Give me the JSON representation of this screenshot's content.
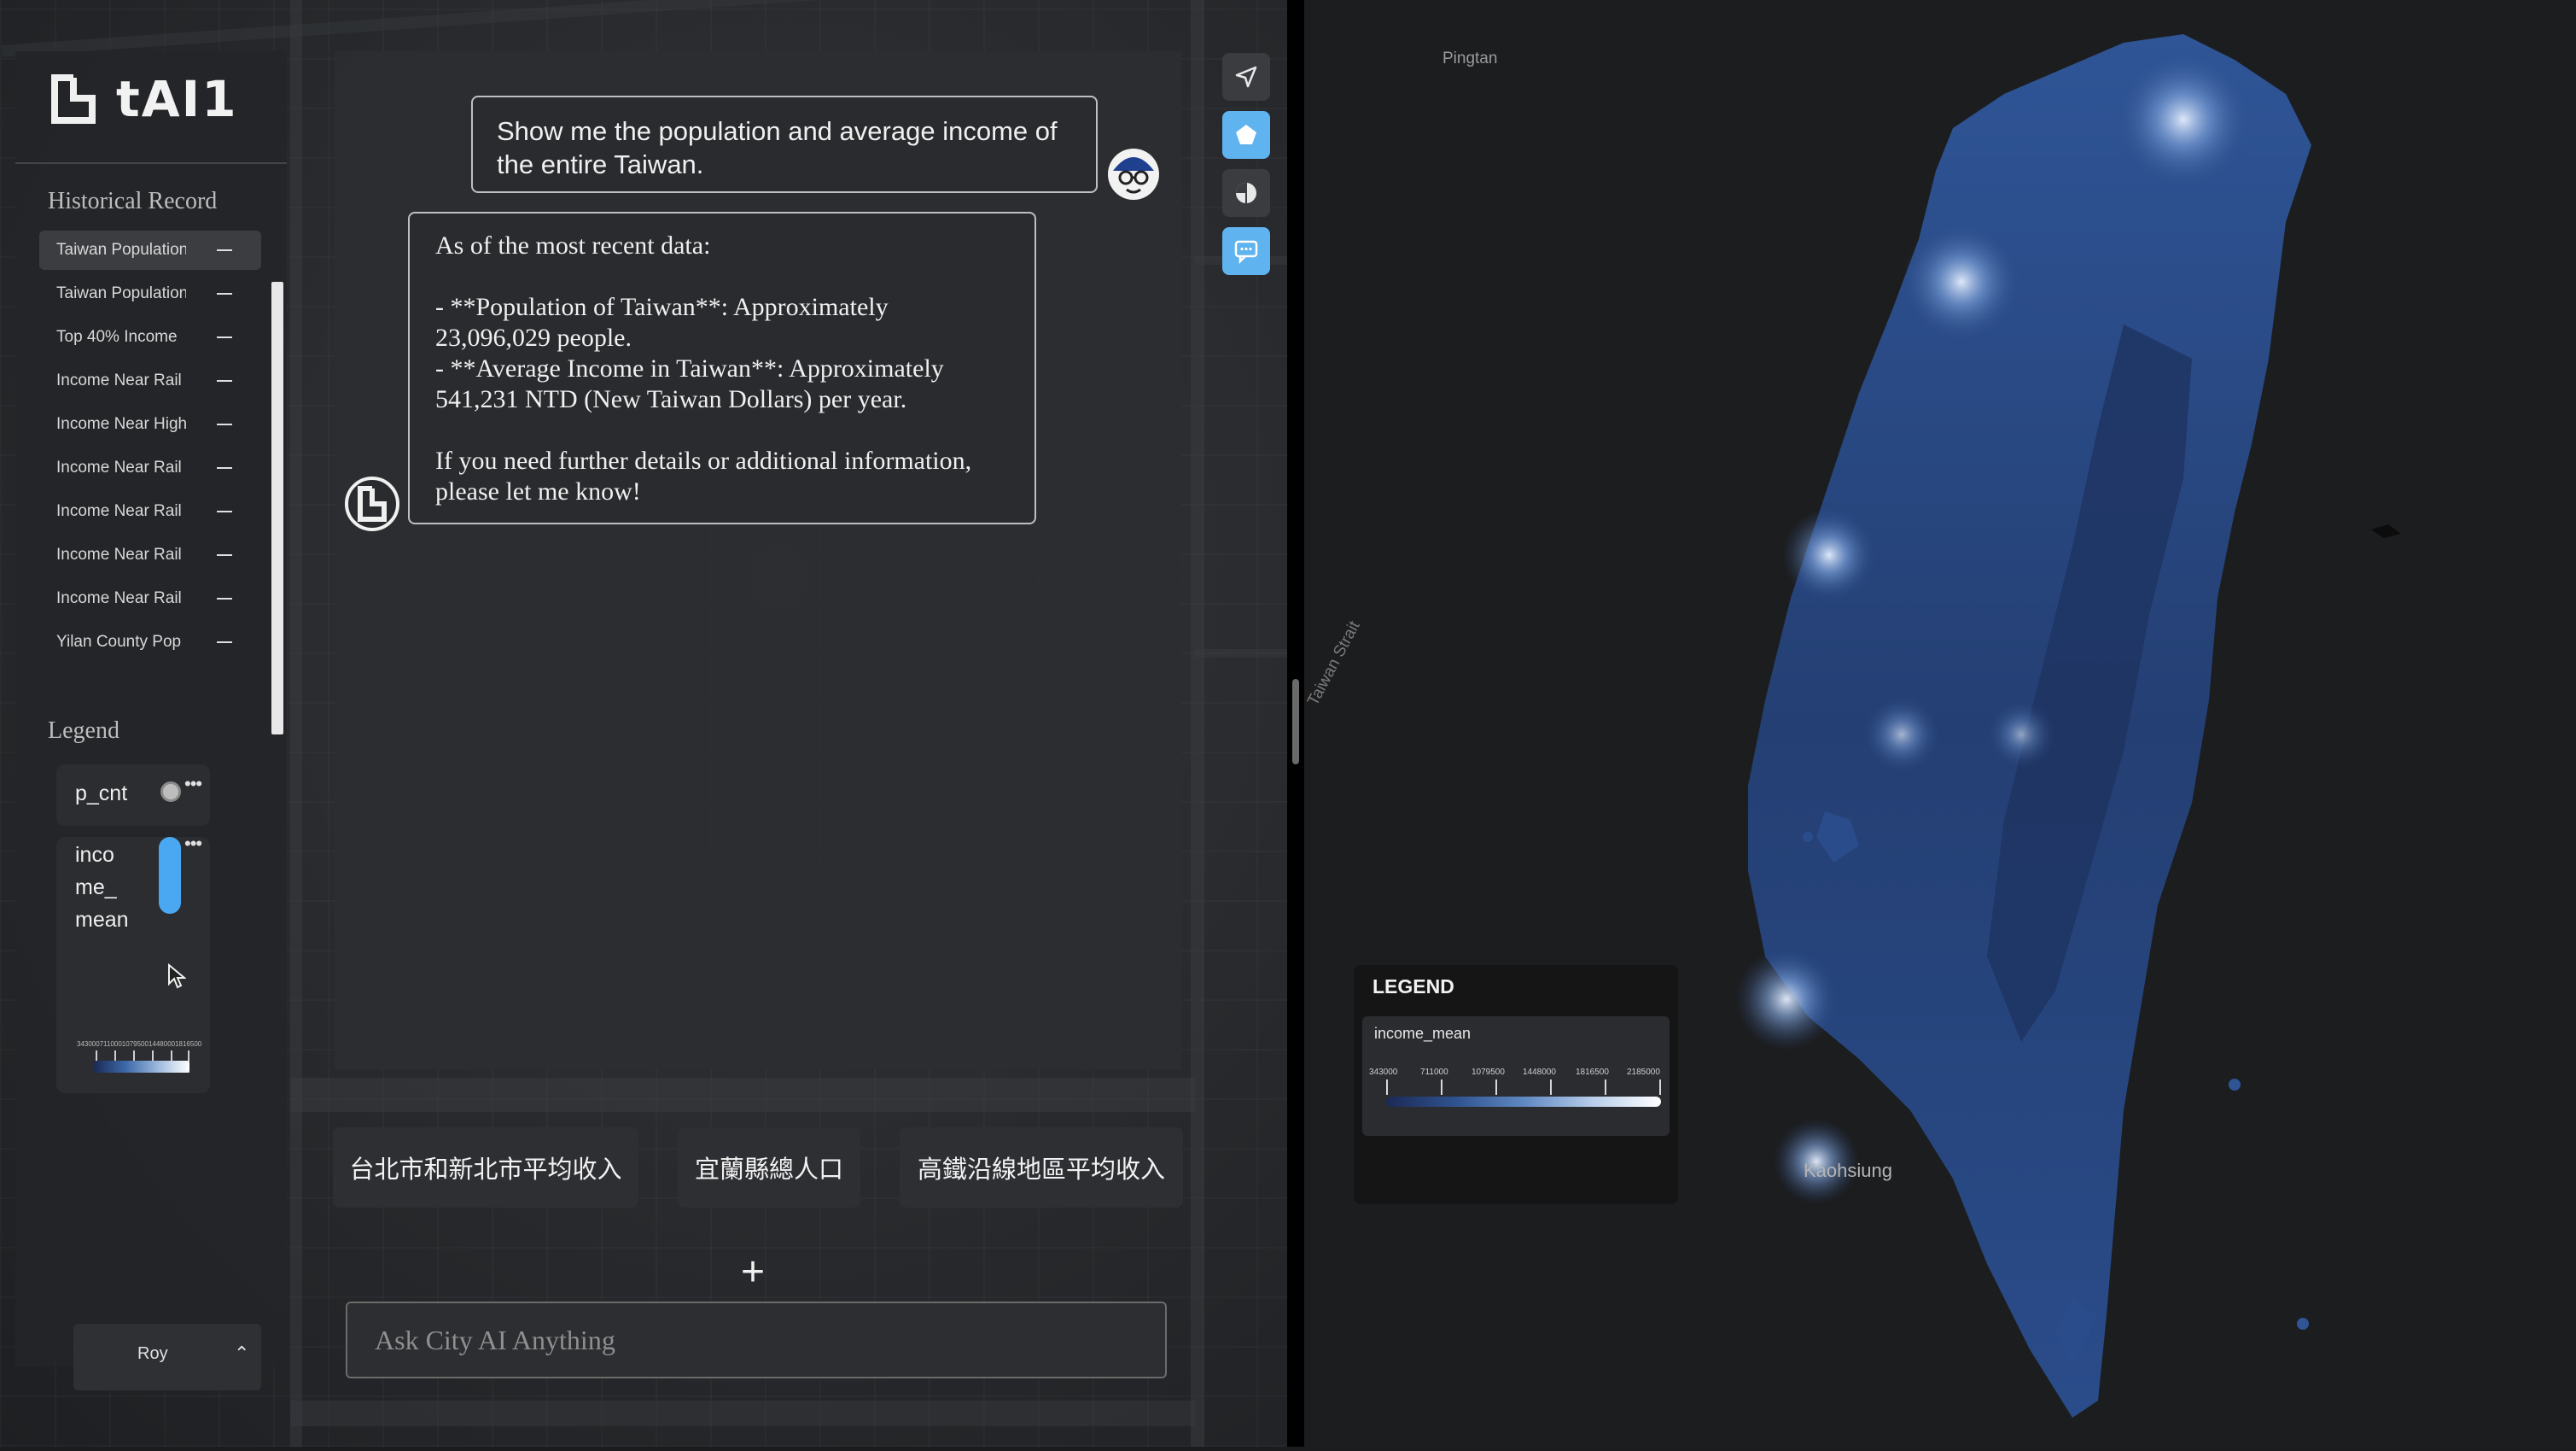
{
  "app": {
    "logo_text": "tAI1"
  },
  "sidebar": {
    "history_title": "Historical Record",
    "history": [
      {
        "label": "Taiwan Population",
        "active": true
      },
      {
        "label": "Taiwan Population"
      },
      {
        "label": "Top 40% Income"
      },
      {
        "label": "Income Near Rail"
      },
      {
        "label": "Income Near High"
      },
      {
        "label": "Income Near Rail"
      },
      {
        "label": "Income Near Rail"
      },
      {
        "label": "Income Near Rail"
      },
      {
        "label": "Income Near Rail"
      },
      {
        "label": "Yilan County Pop"
      }
    ],
    "legend_title": "Legend",
    "legend_layers": [
      {
        "name": "p_cnt",
        "symbol": "circle"
      },
      {
        "name": "inco\nme_\nmean",
        "symbol": "gradient-pill",
        "color": "#4aa8f2"
      }
    ],
    "legend_mini_scale": "343000711000107950014480001816500",
    "user": {
      "name": "Roy"
    }
  },
  "chat": {
    "user_message": "Show me the population and average income of the entire Taiwan.",
    "ai_message": [
      "As of the most recent data:",
      "- **Population of Taiwan**: Approximately 23,096,029 people.",
      "- **Average Income in Taiwan**: Approximately 541,231 NTD (New Taiwan Dollars) per year.",
      "If you need further details or additional information, please let me know!"
    ]
  },
  "tools": [
    {
      "icon": "navigate-arrow-icon",
      "active": false
    },
    {
      "icon": "polygon-icon",
      "active": true
    },
    {
      "icon": "pie-chart-icon",
      "active": false
    },
    {
      "icon": "chat-icon",
      "active": true
    }
  ],
  "suggestions": [
    "台北市和新北市平均收入",
    "宜蘭縣總人口",
    "高鐵沿線地區平均收入"
  ],
  "input": {
    "placeholder": "Ask City AI Anything",
    "value": ""
  },
  "map": {
    "labels": {
      "pingtan": "Pingtan",
      "strait": "Taiwan Strait",
      "kaohsiung": "Kaohsiung"
    },
    "legend": {
      "title": "LEGEND",
      "field": "income_mean",
      "ticks": [
        "343000",
        "711000",
        "1079500",
        "1448000",
        "1816500",
        "2185000"
      ],
      "ramp_colors": [
        "#1b2a55",
        "#2f528e",
        "#5f88c2",
        "#b7cdea",
        "#ffffff"
      ]
    }
  },
  "colors": {
    "accent": "#5fb3ee",
    "panel": "#2c2d30",
    "background": "#1b1c1e"
  }
}
